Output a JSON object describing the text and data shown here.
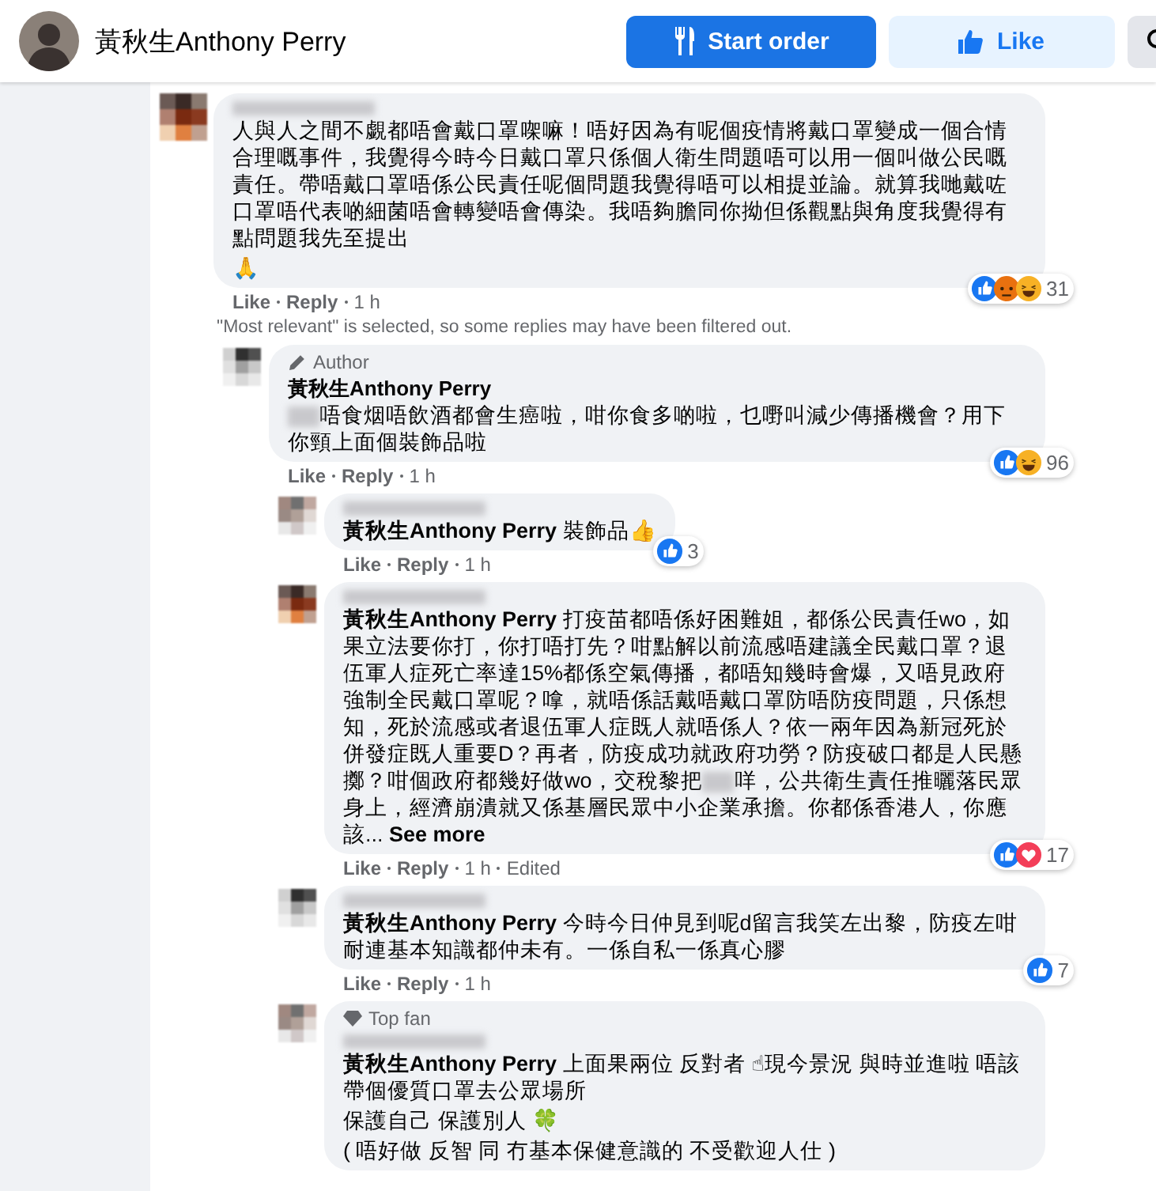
{
  "header": {
    "page_name": "黃秋生Anthony Perry",
    "buttons": [
      {
        "label": "Start order",
        "kind": "order"
      },
      {
        "label": "Like",
        "kind": "like"
      },
      {
        "kind": "search"
      }
    ]
  },
  "comments": [
    {
      "body": [
        {
          "kind": "text",
          "text": "人與人之間不覷都唔會戴口罩㗎嘛！唔好因為有呢個疫情將戴口罩變成一個合情合理嘅事件，我覺得今時今日戴口罩只係個人衛生問題唔可以用一個叫做公民嘅責任。帶唔戴口罩唔係公民責任呢個問題我覺得唔可以相提並論。就算我哋戴咗口罩唔代表啲細菌唔會轉變唔會傳染。我唔夠膽同你拗但係觀點與角度我覺得有點問題我先至提出"
        },
        {
          "kind": "line",
          "text": "🙏"
        }
      ],
      "reactions": {
        "icons": [
          {
            "kind": "like"
          },
          {
            "kind": "angry"
          },
          {
            "kind": "haha"
          }
        ],
        "count": "31"
      },
      "actions": [
        "Like",
        "Reply",
        "1 h"
      ],
      "notice": "\"Most relevant\" is selected, so some replies may have been filtered out.",
      "children": [
        {
          "badge": {
            "kind": "author",
            "label": "Author"
          },
          "author": "黃秋生Anthony Perry",
          "body": [
            {
              "kind": "blur"
            },
            {
              "kind": "text",
              "text": "唔食烟唔飲酒都會生癌啦，咁你食多啲啦，乜嘢叫減少傳播機會？用下你頸上面個裝飾品啦"
            }
          ],
          "reactions": {
            "icons": [
              {
                "kind": "like"
              },
              {
                "kind": "haha"
              }
            ],
            "count": "96"
          },
          "actions": [
            "Like",
            "Reply",
            "1 h"
          ],
          "children": [
            {
              "body": [
                {
                  "kind": "mention",
                  "text": "黃秋生Anthony Perry"
                },
                {
                  "kind": "text",
                  "text": " 裝飾品👍"
                }
              ],
              "reactions": {
                "icons": [
                  {
                    "kind": "like"
                  }
                ],
                "count": "3"
              },
              "actions": [
                "Like",
                "Reply",
                "1 h"
              ]
            },
            {
              "body": [
                {
                  "kind": "mention",
                  "text": "黃秋生Anthony Perry"
                },
                {
                  "kind": "text",
                  "text": " 打疫苗都唔係好困難姐，都係公民責任wo，如果立法要你打，你打唔打先？咁點解以前流感唔建議全民戴口罩？退伍軍人症死亡率達15%都係空氣傳播，都唔知幾時會爆，又唔見政府強制全民戴口罩呢？嗱，就唔係話戴唔戴口罩防唔防疫問題，只係想知，死於流感或者退伍軍人症既人就唔係人？依一兩年因為新冠死於併發症既人重要D？再者，防疫成功就政府功勞？防疫破口都是人民懸擲？咁個政府都幾好做wo，交稅黎把"
                },
                {
                  "kind": "blur"
                },
                {
                  "kind": "text",
                  "text": "咩，公共衛生責任推曬落民眾身上，經濟崩潰就又係基層民眾中小企業承擔。你都係香港人，你應該..."
                },
                {
                  "kind": "link",
                  "text": " See more"
                }
              ],
              "reactions": {
                "icons": [
                  {
                    "kind": "like"
                  },
                  {
                    "kind": "love"
                  }
                ],
                "count": "17"
              },
              "actions": [
                "Like",
                "Reply",
                "1 h",
                "Edited"
              ]
            },
            {
              "body": [
                {
                  "kind": "mention",
                  "text": "黃秋生Anthony Perry"
                },
                {
                  "kind": "text",
                  "text": " 今時今日仲見到呢d留言我笑左出黎，防疫左咁耐連基本知識都仲未有。一係自私一係真心膠"
                }
              ],
              "reactions": {
                "icons": [
                  {
                    "kind": "like"
                  }
                ],
                "count": "7"
              },
              "actions": [
                "Like",
                "Reply",
                "1 h"
              ]
            },
            {
              "badge": {
                "kind": "topfan",
                "label": "Top fan"
              },
              "body": [
                {
                  "kind": "mention",
                  "text": "黃秋生Anthony Perry"
                },
                {
                  "kind": "text",
                  "text": " 上面果兩位 反對者 ☝現今景況 與時並進啦 唔該帶個優質口罩去公眾場所"
                },
                {
                  "kind": "line",
                  "text": "保護自己 保護別人 🍀"
                },
                {
                  "kind": "line",
                  "text": "( 唔好做 反智 同 冇基本保健意識的 不受歡迎人仕 )"
                }
              ]
            }
          ]
        }
      ]
    }
  ]
}
